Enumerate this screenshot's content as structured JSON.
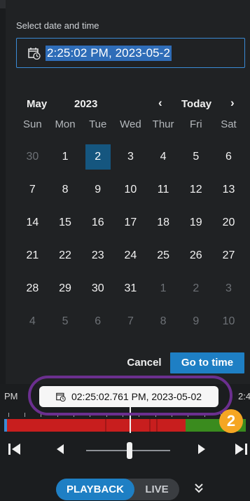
{
  "picker": {
    "label": "Select date and time",
    "input_value": "2:25:02 PM, 2023-05-2",
    "month": "May",
    "year": "2023",
    "prev": "‹",
    "today": "Today",
    "next": "›",
    "weekdays": [
      "Sun",
      "Mon",
      "Tue",
      "Wed",
      "Thur",
      "Fri",
      "Sat"
    ],
    "weeks": [
      [
        "30",
        "1",
        "2",
        "3",
        "4",
        "5",
        "6"
      ],
      [
        "7",
        "8",
        "9",
        "10",
        "11",
        "12",
        "13"
      ],
      [
        "14",
        "15",
        "16",
        "17",
        "18",
        "19",
        "20"
      ],
      [
        "21",
        "22",
        "23",
        "24",
        "25",
        "26",
        "27"
      ],
      [
        "28",
        "29",
        "30",
        "31",
        "1",
        "2",
        "3"
      ],
      [
        "4",
        "5",
        "6",
        "7",
        "8",
        "9",
        "10"
      ]
    ],
    "selected_day": "2",
    "cancel": "Cancel",
    "go": "Go to time"
  },
  "timeline": {
    "left_label": "PM",
    "right_label": "2:4",
    "current_time": "02:25:02.761 PM, 2023-05-02",
    "badge": "2"
  },
  "mode": {
    "playback": "PLAYBACK",
    "live": "LIVE"
  },
  "colors": {
    "accent": "#1e7fc4",
    "recording_red": "#c81e1e",
    "recording_green": "#3a8b1e",
    "highlight_ring": "#6b2f8f",
    "badge": "#f5a623"
  }
}
